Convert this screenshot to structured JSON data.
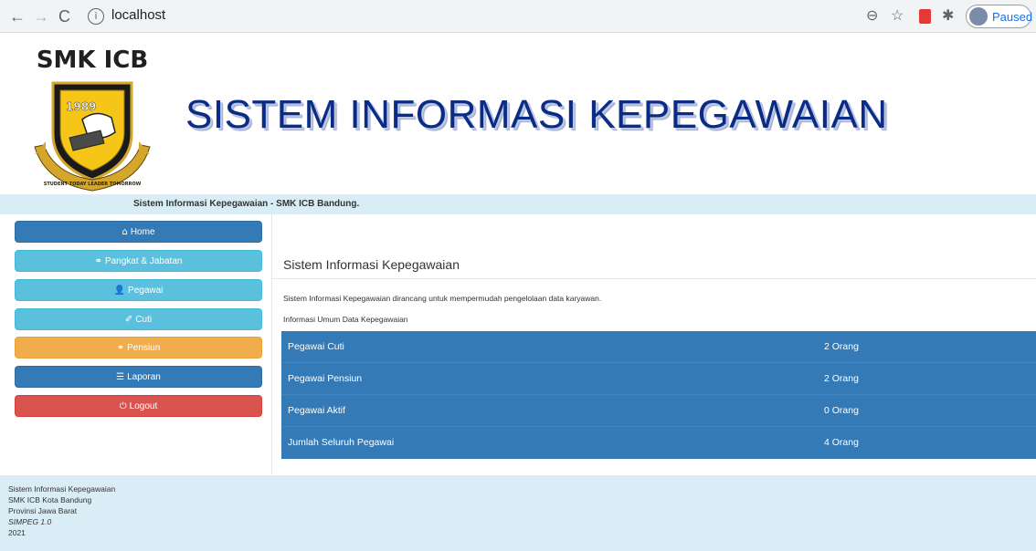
{
  "browser": {
    "back_icon": "←",
    "forward_icon": "→",
    "reload_icon": "C",
    "info_icon": "i",
    "url": "localhost",
    "zoom_icon": "⊖",
    "star_icon": "☆",
    "puzzle_icon": "✱",
    "profile_label": "Paused"
  },
  "header": {
    "logo_text": "SMK ICB",
    "logo_year": "1989",
    "logo_motto": "STUDENT TODAY LEADER TOMORROW",
    "title": "SISTEM INFORMASI KEPEGAWAIAN"
  },
  "strip": {
    "text": "Sistem Informasi Kepegawaian - SMK ICB Bandung."
  },
  "sidebar": {
    "items": [
      {
        "icon": "⌂",
        "label": "Home"
      },
      {
        "icon": "⚭",
        "label": "Pangkat & Jabatan"
      },
      {
        "icon": "👤",
        "label": "Pegawai"
      },
      {
        "icon": "✐",
        "label": "Cuti"
      },
      {
        "icon": "⚭",
        "label": "Pensiun"
      },
      {
        "icon": "☰",
        "label": "Laporan"
      },
      {
        "icon": "⏻",
        "label": "Logout"
      }
    ]
  },
  "main": {
    "title": "Sistem Informasi Kepegawaian",
    "description": "Sistem Informasi Kepegawaian dirancang untuk mempermudah pengelolaan data karyawan.",
    "section_heading": "Informasi Umum Data Kepegawaian",
    "stats": [
      {
        "label": "Pegawai Cuti",
        "value": "2 Orang"
      },
      {
        "label": "Pegawai Pensiun",
        "value": "2 Orang"
      },
      {
        "label": "Pegawai Aktif",
        "value": "0 Orang"
      },
      {
        "label": "Jumlah Seluruh Pegawai",
        "value": "4 Orang"
      }
    ]
  },
  "footer": {
    "line1": "Sistem Informasi Kepegawaian",
    "line2": "SMK ICB Kota Bandung",
    "line3": "Provinsi Jawa Barat",
    "line4": "SIMPEG 1.0",
    "line5": "2021"
  },
  "colors": {
    "primary": "#337ab7",
    "info": "#5bc0de",
    "warning": "#f0ad4e",
    "danger": "#d9534f",
    "strip": "#d9edf7",
    "title": "#0b2c85"
  }
}
